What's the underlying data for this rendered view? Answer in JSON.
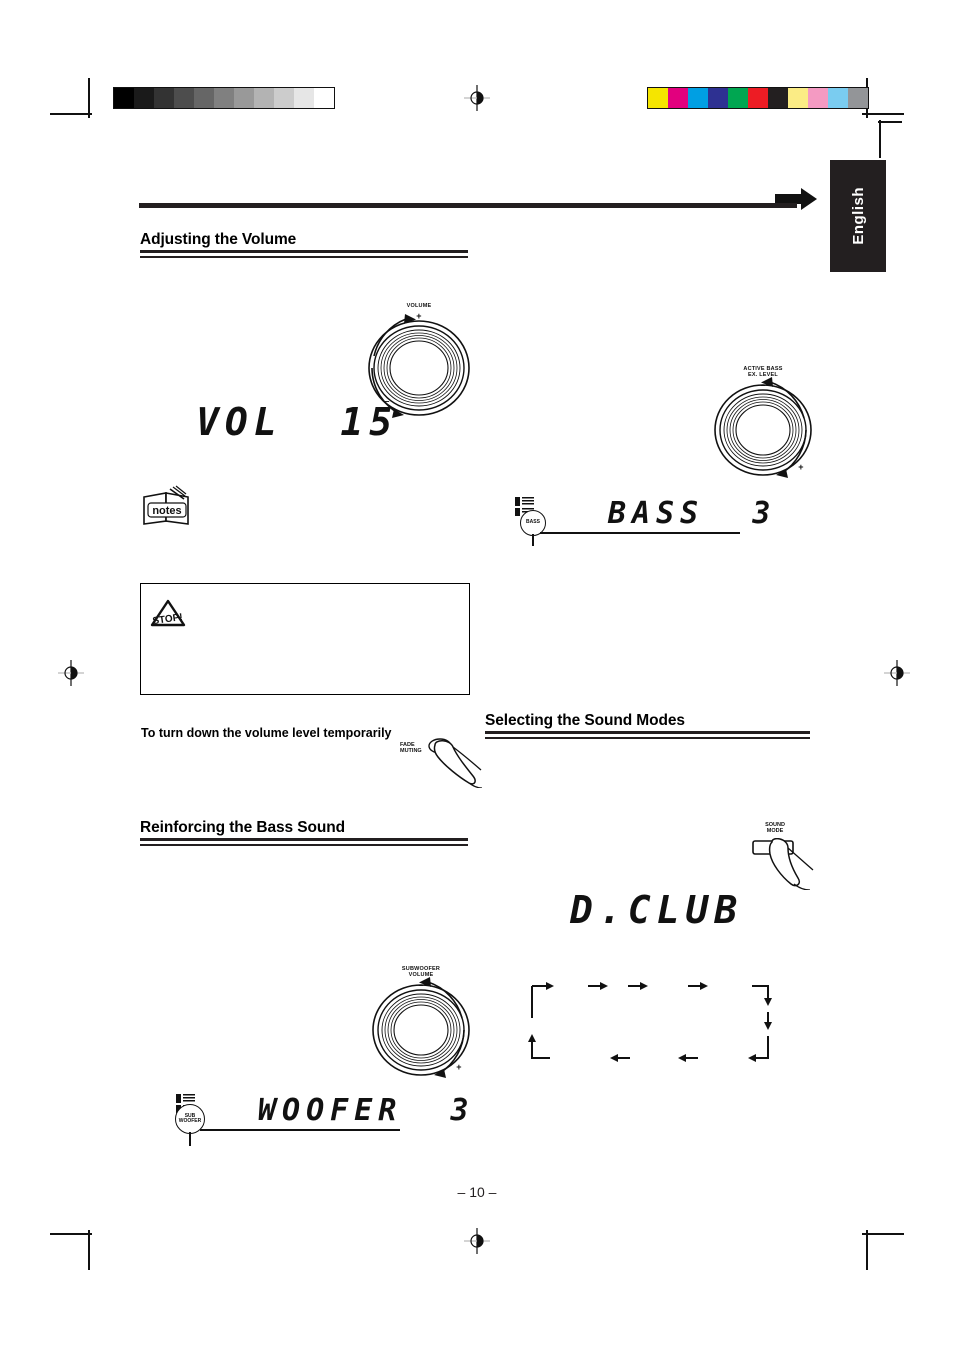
{
  "document": {
    "language_tab": "English",
    "page_number": "– 10 –"
  },
  "print_marks": {
    "grayscale_swatches": [
      "#000000",
      "#1a1a1a",
      "#333333",
      "#4d4d4d",
      "#666666",
      "#808080",
      "#999999",
      "#b3b3b3",
      "#cccccc",
      "#e6e6e6",
      "#ffffff"
    ],
    "color_swatches": [
      "#f5e500",
      "#e2007e",
      "#009fe3",
      "#2e3192",
      "#00a651",
      "#ed1c24",
      "#231f20",
      "#fbec85",
      "#f49ac2",
      "#7accf0",
      "#939598"
    ],
    "registration_icon": "registration-target-icon"
  },
  "sections": {
    "volume": {
      "heading": "Adjusting the Volume",
      "knob": {
        "label": "VOLUME",
        "plus": "+",
        "minus": "–",
        "icon": "rotary-knob-icon"
      },
      "display_value": "VOL  15",
      "notes_icon": "notes-icon",
      "caution_icon": "stop-caution-icon",
      "subheading": "To turn down the volume level temporarily",
      "button": {
        "label": "FADE\nMUTING",
        "icon": "finger-press-button-icon"
      }
    },
    "bass": {
      "heading": "Reinforcing the Bass Sound",
      "active_bass_knob": {
        "label": "ACTIVE BASS\nEX. LEVEL",
        "plus": "+",
        "minus": "–",
        "icon": "rotary-knob-icon"
      },
      "bass_display_value": "BASS  3",
      "bass_indicator_callout": "BASS",
      "bass_indicator_icon": "display-indicator-icon",
      "subwoofer_knob": {
        "label": "SUBWOOFER\nVOLUME",
        "plus": "+",
        "minus": "–",
        "icon": "rotary-knob-icon"
      },
      "woofer_display_value": "WOOFER  3",
      "woofer_indicator_callout": "SUB\nWOOFER",
      "woofer_indicator_icon": "display-indicator-icon"
    },
    "sound_modes": {
      "heading": "Selecting the Sound Modes",
      "button": {
        "label": "SOUND\nMODE",
        "icon": "finger-press-button-icon"
      },
      "display_value": "D.CLUB",
      "flow_diagram": {
        "type": "cycle",
        "items": [
          "",
          "",
          "",
          "",
          "",
          "",
          "",
          ""
        ]
      }
    }
  }
}
